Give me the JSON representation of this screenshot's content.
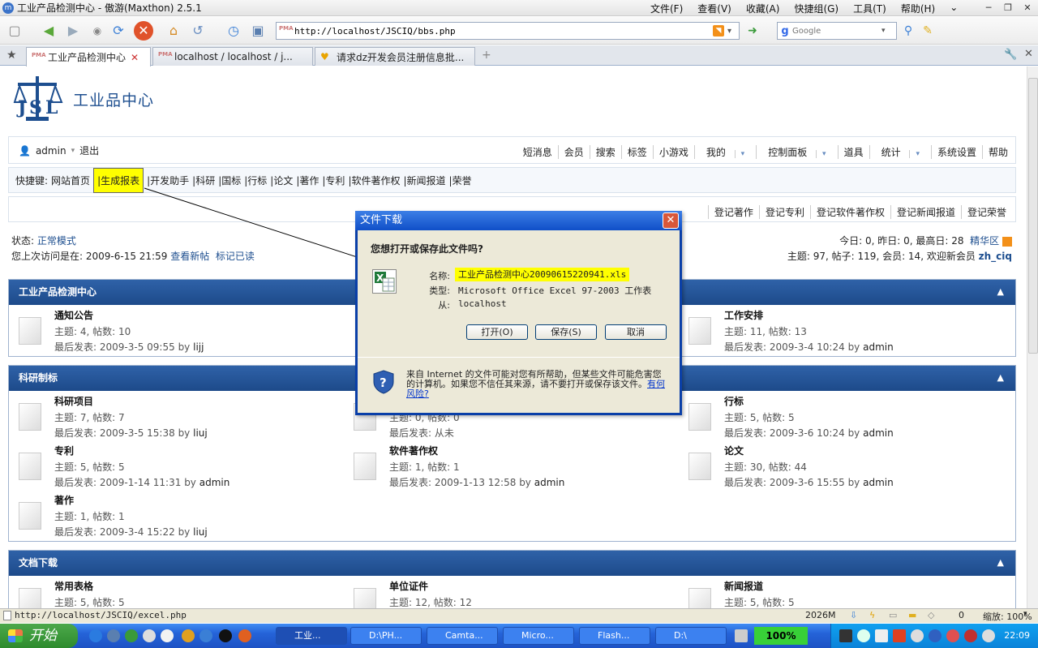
{
  "window": {
    "title": "工业产品检测中心 - 傲游(Maxthon) 2.5.1",
    "menu": [
      "文件(F)",
      "查看(V)",
      "收藏(A)",
      "快捷组(G)",
      "工具(T)",
      "帮助(H)"
    ]
  },
  "toolbar": {
    "address": "http://localhost/JSCIQ/bbs.php",
    "search_placeholder": "Google"
  },
  "tabs": [
    {
      "label": "工业产品检测中心"
    },
    {
      "label": "localhost / localhost / j..."
    },
    {
      "label": "请求dz开发会员注册信息批..."
    }
  ],
  "site": {
    "name": "工业品中心"
  },
  "userbar": {
    "user": "admin",
    "logout": "退出",
    "links": [
      "短消息",
      "会员",
      "搜索",
      "标签",
      "小游戏",
      "我的",
      "控制面板",
      "道具",
      "统计",
      "系统设置",
      "帮助"
    ]
  },
  "quick": {
    "label": "快捷键:",
    "items": [
      "网站首页",
      "|生成报表",
      "|开发助手",
      "|科研",
      "|国标",
      "|行标",
      "|论文",
      "|著作",
      "|专利",
      "|软件著作权",
      "|新闻报道",
      "|荣誉"
    ]
  },
  "regbar": {
    "links": [
      "登记著作",
      "登记专利",
      "登记软件著作权",
      "登记新闻报道",
      "登记荣誉"
    ]
  },
  "status": {
    "mode_label": "状态:",
    "mode": "正常模式",
    "last_visit": "您上次访问是在: 2009-6-15 21:59",
    "new_posts": "查看新帖",
    "mark_read": "标记已读",
    "today": "今日: 0, 昨日: 0, 最高日: 28",
    "digest": "精华区",
    "totals": "主题: 97, 帖子: 119, 会员: 14, 欢迎新会员",
    "new_member": "zh_ciq"
  },
  "sections": [
    {
      "title": "工业产品检测中心",
      "forums": [
        {
          "name": "通知公告",
          "meta": "主题: 4, 帖数: 10",
          "last": "最后发表: 2009-3-5 09:55",
          "by": "by",
          "user": "lijj"
        },
        {
          "name": "工作安排",
          "meta": "主题: 11, 帖数: 13",
          "last": "最后发表: 2009-3-4 10:24",
          "by": "by",
          "user": "admin"
        }
      ]
    },
    {
      "title": "科研制标",
      "forums": [
        {
          "name": "科研项目",
          "meta": "主题: 7, 帖数: 7",
          "last": "最后发表: 2009-3-5 15:38",
          "by": "by",
          "user": "liuj"
        },
        {
          "name": "",
          "meta": "主题: 0, 帖数: 0",
          "last": "最后发表: 从未",
          "by": "",
          "user": ""
        },
        {
          "name": "行标",
          "meta": "主题: 5, 帖数: 5",
          "last": "最后发表: 2009-3-6 10:24",
          "by": "by",
          "user": "admin"
        },
        {
          "name": "专利",
          "meta": "主题: 5, 帖数: 5",
          "last": "最后发表: 2009-1-14 11:31",
          "by": "by",
          "user": "admin"
        },
        {
          "name": "软件著作权",
          "meta": "主题: 1, 帖数: 1",
          "last": "最后发表: 2009-1-13 12:58",
          "by": "by",
          "user": "admin"
        },
        {
          "name": "论文",
          "meta": "主题: 30, 帖数: 44",
          "last": "最后发表: 2009-3-6 15:55",
          "by": "by",
          "user": "admin"
        },
        {
          "name": "著作",
          "meta": "主题: 1, 帖数: 1",
          "last": "最后发表: 2009-3-4 15:22",
          "by": "by",
          "user": "liuj"
        }
      ]
    },
    {
      "title": "文档下载",
      "forums": [
        {
          "name": "常用表格",
          "meta": "主题: 5, 帖数: 5"
        },
        {
          "name": "单位证件",
          "meta": "主题: 12, 帖数: 12"
        },
        {
          "name": "新闻报道",
          "meta": "主题: 5, 帖数: 5"
        }
      ]
    }
  ],
  "dialog": {
    "title": "文件下载",
    "question": "您想打开或保存此文件吗?",
    "name_label": "名称:",
    "name": "工业产品检测中心20090615220941.xls",
    "type_label": "类型:",
    "type": "Microsoft Office Excel 97-2003 工作表",
    "from_label": "从:",
    "from": "localhost",
    "open": "打开(O)",
    "save": "保存(S)",
    "cancel": "取消",
    "warning": "来自 Internet 的文件可能对您有所帮助，但某些文件可能危害您的计算机。如果您不信任其来源，请不要打开或保存该文件。",
    "risk_link": "有何风险?"
  },
  "statusbar": {
    "url": "http://localhost/JSCIQ/excel.php",
    "memory": "2026M",
    "count": "0",
    "zoom": "缩放: 100%"
  },
  "taskbar": {
    "start": "开始",
    "tasks": [
      "工业...",
      "D:\\PH...",
      "Camta...",
      "Micro...",
      "Flash...",
      "D:\\"
    ],
    "percent": "100%",
    "clock": "22:09"
  }
}
